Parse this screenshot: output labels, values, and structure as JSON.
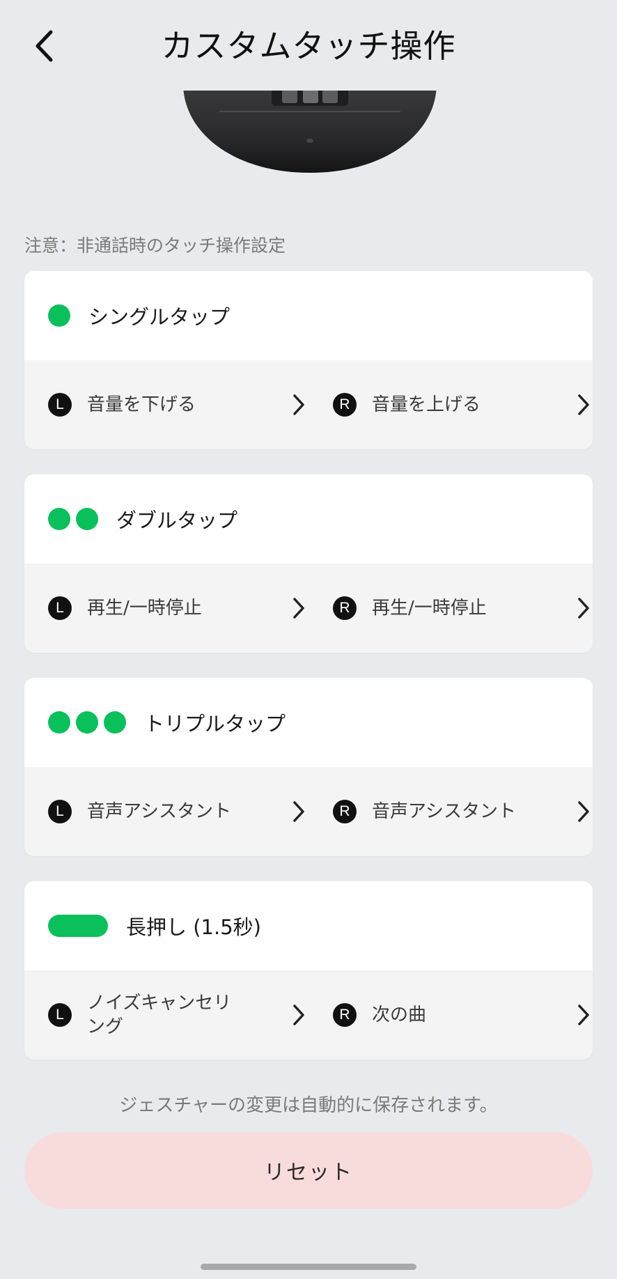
{
  "header": {
    "title": "カスタムタッチ操作"
  },
  "note": "注意：非通話時のタッチ操作設定",
  "gestures": [
    {
      "title": "シングルタップ",
      "left": {
        "badge": "L",
        "value": "音量を下げる"
      },
      "right": {
        "badge": "R",
        "value": "音量を上げる"
      }
    },
    {
      "title": "ダブルタップ",
      "left": {
        "badge": "L",
        "value": "再生/一時停止"
      },
      "right": {
        "badge": "R",
        "value": "再生/一時停止"
      }
    },
    {
      "title": "トリプルタップ",
      "left": {
        "badge": "L",
        "value": "音声アシスタント"
      },
      "right": {
        "badge": "R",
        "value": "音声アシスタント"
      }
    },
    {
      "title": "長押し (1.5秒)",
      "left": {
        "badge": "L",
        "value": "ノイズキャンセリング"
      },
      "right": {
        "badge": "R",
        "value": "次の曲"
      }
    }
  ],
  "save_note": "ジェスチャーの変更は自動的に保存されます。",
  "reset_label": "リセット",
  "colors": {
    "accent": "#09C05B",
    "reset_bg": "#F8DCDB",
    "background": "#E9EAEE"
  }
}
